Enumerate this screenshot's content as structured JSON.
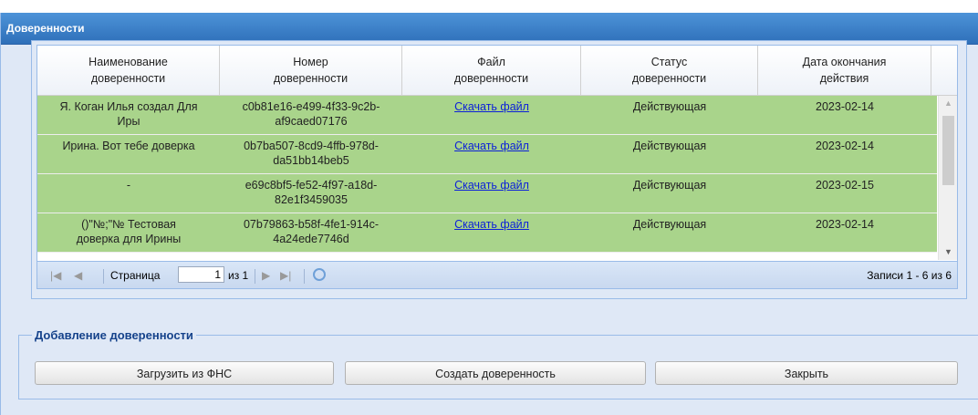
{
  "window": {
    "title": "Доверенности"
  },
  "grid": {
    "columns": [
      "Наименование\nдоверенности",
      "Номер\nдоверенности",
      "Файл\nдоверенности",
      "Статус\nдоверенности",
      "Дата окончания\nдействия"
    ],
    "rows": [
      {
        "name": "Я. Коган Илья создал Для\nИры",
        "number": "c0b81e16-e499-4f33-9c2b-\naf9caed07176",
        "file": "Скачать файл",
        "status": "Действующая",
        "date": "2023-02-14"
      },
      {
        "name": "Ирина. Вот тебе доверка",
        "number": "0b7ba507-8cd9-4ffb-978d-\nda51bb14beb5",
        "file": "Скачать файл",
        "status": "Действующая",
        "date": "2023-02-14"
      },
      {
        "name": "-",
        "number": "e69c8bf5-fe52-4f97-a18d-\n82e1f3459035",
        "file": "Скачать файл",
        "status": "Действующая",
        "date": "2023-02-15"
      },
      {
        "name": "()\"№;\"№ Тестовая\nдоверка для Ирины",
        "number": "07b79863-b58f-4fe1-914c-\n4a24ede7746d",
        "file": "Скачать файл",
        "status": "Действующая",
        "date": "2023-02-14"
      }
    ]
  },
  "pager": {
    "page_label": "Страница",
    "page_value": "1",
    "of_label": "из 1",
    "records": "Записи 1 - 6 из 6"
  },
  "add_section": {
    "legend": "Добавление доверенности",
    "buttons": {
      "load": "Загрузить из ФНС",
      "create": "Создать доверенность",
      "close": "Закрыть"
    }
  },
  "colors": {
    "title_bar": "#3a7fc8",
    "row_active": "#a9d48b",
    "panel": "#dfe8f6",
    "link": "#0b1fd9"
  }
}
